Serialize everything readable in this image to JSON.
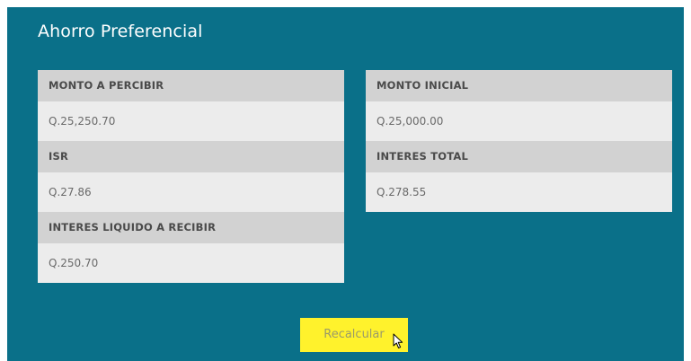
{
  "panel": {
    "title": "Ahorro Preferencial"
  },
  "left_card": {
    "items": [
      {
        "label": "MONTO A PERCIBIR",
        "value": "Q.25,250.70"
      },
      {
        "label": "ISR",
        "value": "Q.27.86"
      },
      {
        "label": "INTERES LIQUIDO A RECIBIR",
        "value": "Q.250.70"
      }
    ]
  },
  "right_card": {
    "items": [
      {
        "label": "MONTO INICIAL",
        "value": "Q.25,000.00"
      },
      {
        "label": "INTERES TOTAL",
        "value": "Q.278.55"
      }
    ]
  },
  "actions": {
    "recalculate_label": "Recalcular"
  },
  "colors": {
    "panel_bg": "#0a7089",
    "label_bg": "#d2d2d2",
    "value_bg": "#ececec",
    "button_bg": "#fff22c"
  },
  "icons": {
    "cursor": "mouse-pointer-icon"
  }
}
